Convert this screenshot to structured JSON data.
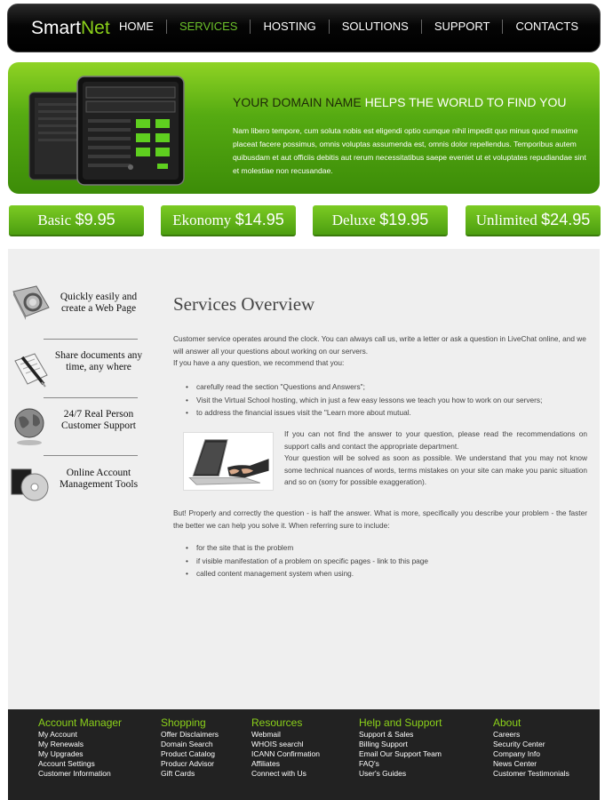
{
  "header": {
    "logo_smart": "Smart",
    "logo_net": "Net",
    "nav": [
      {
        "label": "HOME"
      },
      {
        "label": "SERVICES"
      },
      {
        "label": "HOSTING"
      },
      {
        "label": "SOLUTIONS"
      },
      {
        "label": "SUPPORT"
      },
      {
        "label": "CONTACTS"
      }
    ],
    "active_color": "#6cc12a"
  },
  "hero": {
    "title_dark": "YOUR DOMAIN NAME",
    "title_light": " HELPS THE WORLD TO FIND YOU",
    "text": "Nam libero tempore, cum soluta nobis est eligendi optio cumque nihil impedit quo minus quod maxime placeat facere possimus, omnis voluptas assumenda est, omnis dolor repellendus. Temporibus autem quibusdam et aut officiis debitis aut rerum necessitatibus saepe eveniet ut et voluptates repudiandae sint et molestiae non recusandae.",
    "accent_color": "#56ab12"
  },
  "prices": [
    {
      "name": "Basic",
      "amount": "$9.95"
    },
    {
      "name": "Ekonomy",
      "amount": "$14.95"
    },
    {
      "name": "Deluxe",
      "amount": "$19.95"
    },
    {
      "name": "Unlimited",
      "amount": "$24.95"
    }
  ],
  "sidebar": {
    "items": [
      {
        "line1": "Quickly easily and",
        "line2": "create a Web Page",
        "icon": "web-page-icon"
      },
      {
        "line1": "Share documents any",
        "line2": "time, any where",
        "icon": "documents-pen-icon"
      },
      {
        "line1": "24/7 Real Person",
        "line2": "Customer Support",
        "icon": "globe-icon"
      },
      {
        "line1": "Online Account",
        "line2": "Management Tools",
        "icon": "disc-icon"
      }
    ]
  },
  "main": {
    "title": "Services Overview",
    "intro": "Customer service operates around the clock. You can always call us, write a letter or ask a question in LiveChat online, and we will answer all your questions about working on our servers.",
    "intro2": "If you have a any question, we recommend that you:",
    "list1": [
      "carefully read the section \"Questions and Answers\";",
      "Visit the Virtual School hosting, which in just a few easy lessons we teach you how to work on our servers;",
      "to address the financial issues visit the \"Learn more about mutual."
    ],
    "side_text1": "If you can not find the answer to your question, please read the recommendations on support calls and contact the appropriate department.",
    "side_text2": "Your question will be solved as soon as possible. We understand that you may not know some technical nuances of words, terms mistakes on your site can make you panic situation and so on (sorry for possible exaggeration).",
    "outro": "But! Properly and correctly the question - is half the answer. What is more, specifically you describe your problem - the faster the better we can help you solve it. When referring sure to include:",
    "list2": [
      "for the site that is the problem",
      "if visible manifestation of a problem on specific pages - link to this page",
      "called content management system when using."
    ]
  },
  "footer": {
    "columns": [
      {
        "title": "Account Manager",
        "links": [
          "My Account",
          "My Renewals",
          "My Upgrades",
          "Account Settings",
          "Customer Information"
        ]
      },
      {
        "title": "Shopping",
        "links": [
          "Offer Disclaimers",
          "Domain Search",
          "Product Catalog",
          "Producr Advisor",
          "Gift Cards"
        ]
      },
      {
        "title": "Resources",
        "links": [
          "Webmail",
          "WHOIS searchl",
          "ICANN Confirmation",
          "Affiliates",
          "Connect with Us"
        ]
      },
      {
        "title": "Help and Support",
        "links": [
          "Support & Sales",
          "Billing Support",
          "Email Our Support Team",
          "FAQ's",
          "User's Guides"
        ]
      },
      {
        "title": "About",
        "links": [
          "Careers",
          "Security Center",
          "Company Info",
          "News Center",
          "Customer Testimonials"
        ]
      }
    ]
  }
}
